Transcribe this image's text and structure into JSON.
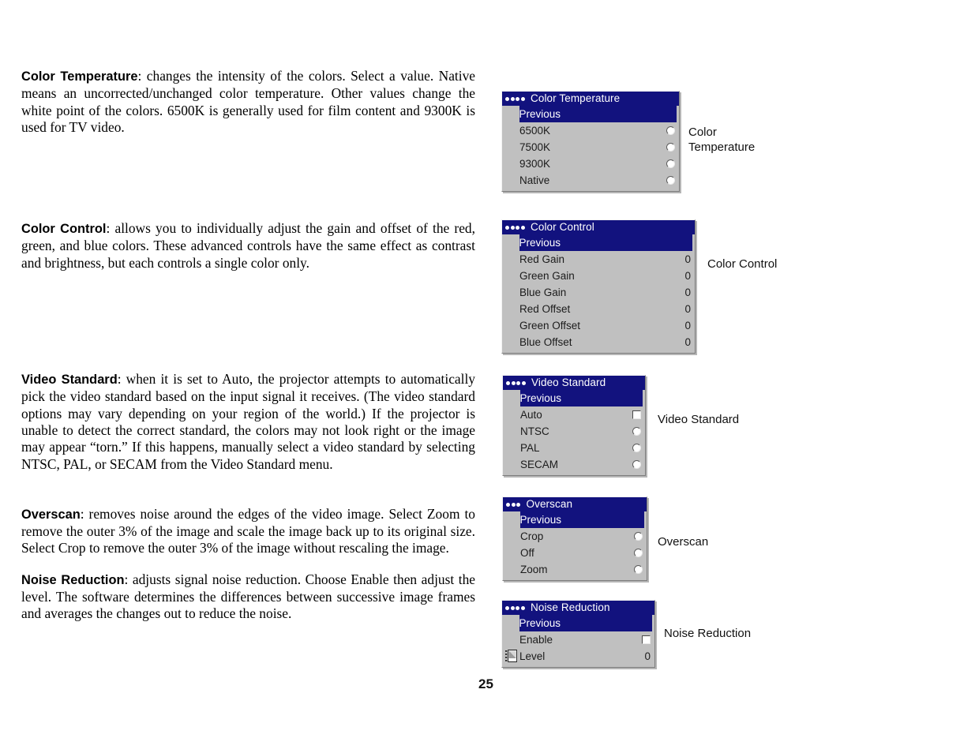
{
  "page": {
    "number": "25"
  },
  "paragraphs": [
    {
      "term": "Color Temperature",
      "text": ": changes the intensity of the colors. Select a value. Native means an uncorrected/unchanged color temperature. Other values change the white point of the colors. 6500K is generally used for film content and 9300K is used for TV video."
    },
    {
      "term": "Color Control",
      "text": ": allows you to individually adjust the gain and offset of the red, green, and blue colors. These advanced controls have the same effect as contrast and brightness, but each controls a single color only."
    },
    {
      "term": "Video Standard",
      "text": ": when it is set to Auto, the projector attempts to automatically pick the video standard based on the input signal it receives. (The video standard options may vary depending on your region of the world.) If the projector is unable to detect the correct standard, the colors may not look right or the image may appear “torn.” If this happens, manually select a video standard by selecting NTSC, PAL, or SECAM from the Video Standard menu."
    },
    {
      "term": "Overscan",
      "text": ": removes noise around the edges of the video image. Select Zoom to remove the outer 3% of the image and scale the image back up to its original size. Select Crop to remove the outer 3% of the image without rescaling the image."
    },
    {
      "term": "Noise Reduction",
      "text": ": adjusts signal noise reduction. Choose Enable then adjust the level. The software determines the differences between successive image frames and averages the changes out to reduce the noise."
    }
  ],
  "colors": {
    "menu_title_bg": "#12127e",
    "menu_bg": "#c0c0c0",
    "menu_title_text": "#ffffff",
    "menu_text": "#1b1b1b"
  },
  "menus": {
    "color_temperature": {
      "title": "Color Temperature",
      "dots": 4,
      "previous": "Previous",
      "rows": [
        {
          "label": "6500K",
          "control": "radio"
        },
        {
          "label": "7500K",
          "control": "radio"
        },
        {
          "label": "9300K",
          "control": "radio"
        },
        {
          "label": "Native",
          "control": "radio"
        }
      ],
      "callout": "Color\nTemperature"
    },
    "color_control": {
      "title": "Color Control",
      "dots": 4,
      "previous": "Previous",
      "rows": [
        {
          "label": "Red Gain",
          "value": "0"
        },
        {
          "label": "Green Gain",
          "value": "0"
        },
        {
          "label": "Blue Gain",
          "value": "0"
        },
        {
          "label": "Red Offset",
          "value": "0"
        },
        {
          "label": "Green Offset",
          "value": "0"
        },
        {
          "label": "Blue Offset",
          "value": "0"
        }
      ],
      "callout": "Color Control"
    },
    "video_standard": {
      "title": "Video Standard",
      "dots": 4,
      "previous": "Previous",
      "rows": [
        {
          "label": "Auto",
          "control": "checkbox"
        },
        {
          "label": "NTSC",
          "control": "radio"
        },
        {
          "label": "PAL",
          "control": "radio"
        },
        {
          "label": "SECAM",
          "control": "radio"
        }
      ],
      "callout": "Video Standard"
    },
    "overscan": {
      "title": "Overscan",
      "dots": 3,
      "previous": "Previous",
      "rows": [
        {
          "label": "Crop",
          "control": "radio"
        },
        {
          "label": "Off",
          "control": "radio"
        },
        {
          "label": "Zoom",
          "control": "radio"
        }
      ],
      "callout": "Overscan"
    },
    "noise_reduction": {
      "title": "Noise Reduction",
      "dots": 4,
      "previous": "Previous",
      "rows": [
        {
          "label": "Enable",
          "control": "checkbox"
        },
        {
          "label": "Level",
          "value": "0",
          "icon": "level-slider-icon"
        }
      ],
      "callout": "Noise Reduction"
    }
  }
}
